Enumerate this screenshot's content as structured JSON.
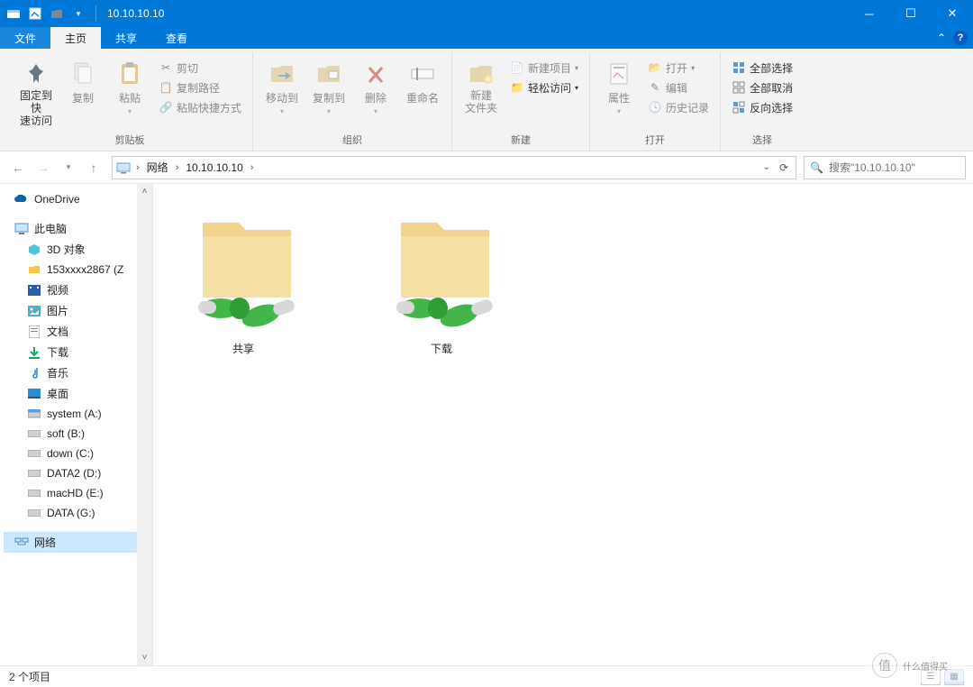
{
  "window": {
    "title": "10.10.10.10"
  },
  "tabs": {
    "file": "文件",
    "home": "主页",
    "share": "共享",
    "view": "查看"
  },
  "ribbon": {
    "clipboard": {
      "pin": "固定到快\n速访问",
      "copy": "复制",
      "paste": "粘贴",
      "cut": "剪切",
      "copy_path": "复制路径",
      "paste_shortcut": "粘贴快捷方式",
      "label": "剪贴板"
    },
    "organize": {
      "move_to": "移动到",
      "copy_to": "复制到",
      "delete": "删除",
      "rename": "重命名",
      "label": "组织"
    },
    "new": {
      "new_folder": "新建\n文件夹",
      "new_item": "新建项目",
      "easy_access": "轻松访问",
      "label": "新建"
    },
    "open": {
      "properties": "属性",
      "open": "打开",
      "edit": "编辑",
      "history": "历史记录",
      "label": "打开"
    },
    "select": {
      "select_all": "全部选择",
      "select_none": "全部取消",
      "invert": "反向选择",
      "label": "选择"
    }
  },
  "breadcrumb": {
    "network": "网络",
    "host": "10.10.10.10"
  },
  "search": {
    "placeholder": "搜索\"10.10.10.10\""
  },
  "sidebar": {
    "onedrive": "OneDrive",
    "this_pc": "此电脑",
    "items": [
      {
        "label": "3D 对象"
      },
      {
        "label": "153xxxx2867 (Z"
      },
      {
        "label": "视频"
      },
      {
        "label": "图片"
      },
      {
        "label": "文档"
      },
      {
        "label": "下载"
      },
      {
        "label": "音乐"
      },
      {
        "label": "桌面"
      },
      {
        "label": "system (A:)"
      },
      {
        "label": "soft (B:)"
      },
      {
        "label": "down (C:)"
      },
      {
        "label": "DATA2 (D:)"
      },
      {
        "label": "macHD (E:)"
      },
      {
        "label": "DATA (G:)"
      }
    ],
    "network": "网络"
  },
  "content": {
    "folders": [
      {
        "name": "共享"
      },
      {
        "name": "下载"
      }
    ]
  },
  "status": {
    "item_count": "2 个项目"
  },
  "watermark": {
    "text": "什么值得买",
    "badge": "值"
  }
}
